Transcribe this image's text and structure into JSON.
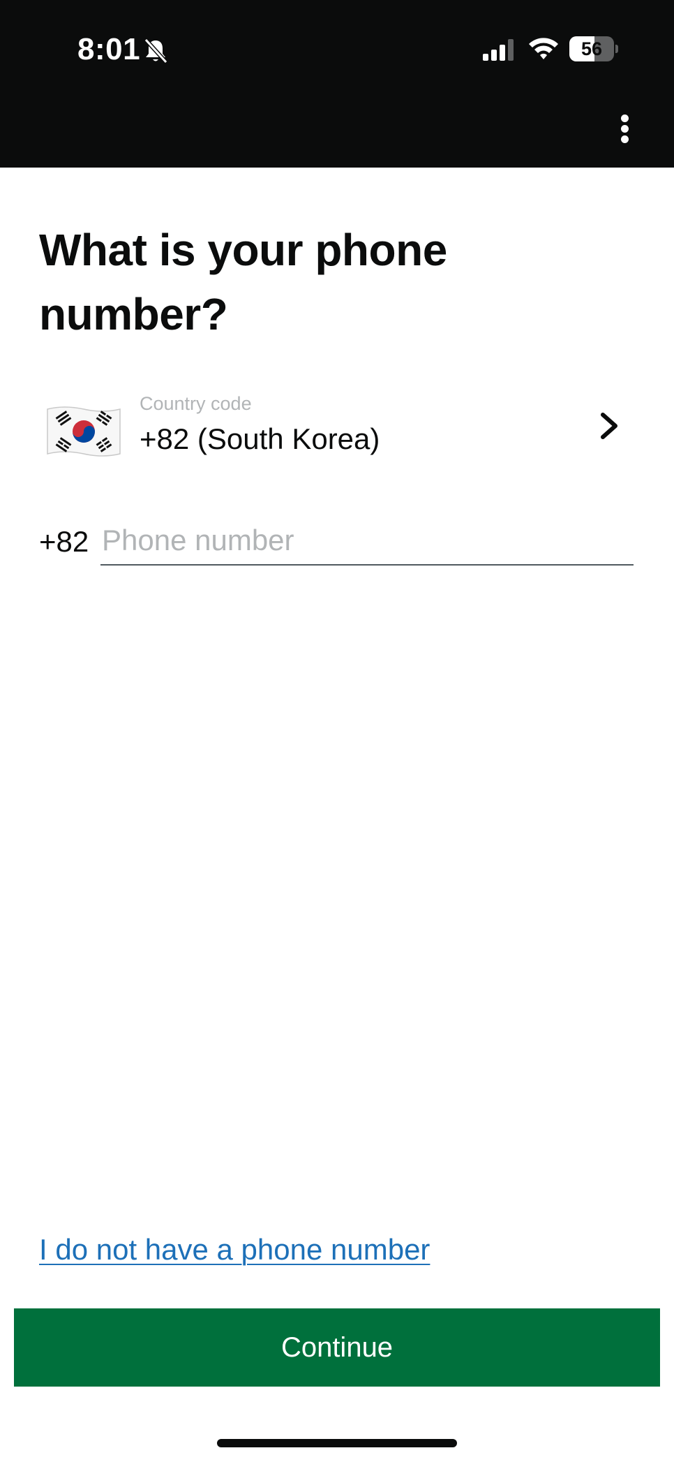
{
  "status_bar": {
    "time": "8:01",
    "battery_percent": "56",
    "battery_level": 0.56
  },
  "header": {
    "menu_icon": "more-vertical-icon"
  },
  "page": {
    "title": "What is your phone number?"
  },
  "country": {
    "label": "Country code",
    "value": "+82 (South Korea)",
    "flag_icon": "south-korea-flag-icon"
  },
  "phone": {
    "prefix": "+82",
    "value": "",
    "placeholder": "Phone number"
  },
  "actions": {
    "no_phone_link": "I do not have a phone number",
    "continue_label": "Continue"
  },
  "colors": {
    "header_background": "#0b0c0c",
    "button_green": "#00703c",
    "link_blue": "#1d70b8",
    "placeholder_gray": "#b1b4b6"
  }
}
